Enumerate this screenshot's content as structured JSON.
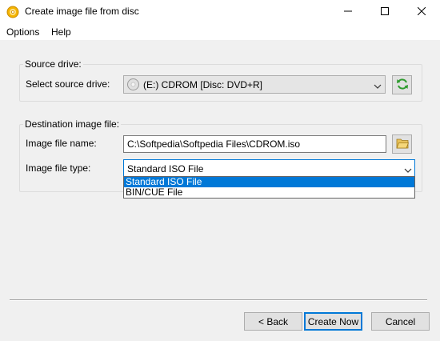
{
  "window": {
    "title": "Create image file from disc",
    "icon": "disc-icon",
    "controls": [
      "minimize-icon",
      "maximize-icon",
      "close-icon"
    ]
  },
  "menu": [
    "Options",
    "Help"
  ],
  "source_group": {
    "label": "Source drive:",
    "select_label": "Select source drive:",
    "drive_value": "(E:) CDROM [Disc: DVD+R]",
    "refresh_icon": "refresh-icon"
  },
  "destination_group": {
    "label": "Destination image file:",
    "file_name_label": "Image file name:",
    "file_name_value": "C:\\Softpedia\\Softpedia Files\\CDROM.iso",
    "browse_icon": "folder-icon",
    "file_type_label": "Image file type:",
    "file_type_value": "Standard ISO File",
    "file_type_options": [
      "Standard ISO File",
      "BIN/CUE File"
    ]
  },
  "buttons": {
    "back": "< Back",
    "create": "Create Now",
    "cancel": "Cancel"
  },
  "colors": {
    "accent": "#0078d7",
    "refresh_green": "#2e9b2e",
    "folder_yellow": "#e8c25a"
  }
}
